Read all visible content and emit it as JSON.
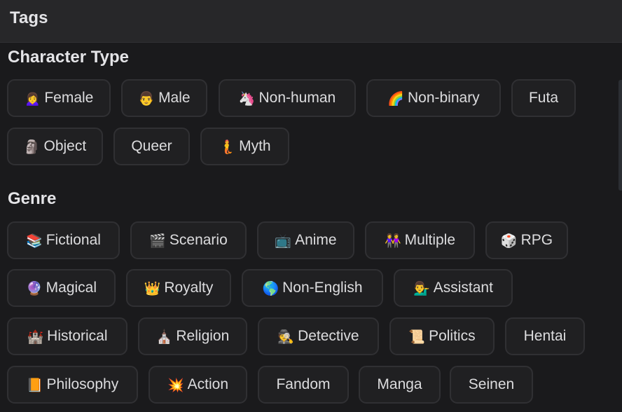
{
  "header": {
    "title": "Tags"
  },
  "sections": [
    {
      "title": "Character Type",
      "rows": [
        [
          {
            "emoji": "🙍‍♀️",
            "icon": "woman-icon",
            "label": "Female"
          },
          {
            "emoji": "👨",
            "icon": "man-icon",
            "label": "Male"
          },
          {
            "emoji": "🦄",
            "icon": "unicorn-icon",
            "label": "Non-human"
          },
          {
            "emoji": "🌈",
            "icon": "rainbow-icon",
            "label": "Non-binary"
          },
          {
            "emoji": "",
            "icon": "",
            "label": "Futa"
          }
        ],
        [
          {
            "emoji": "🗿",
            "icon": "moai-icon",
            "label": "Object"
          },
          {
            "emoji": "",
            "icon": "",
            "label": "Queer"
          },
          {
            "emoji": "🧜",
            "icon": "merperson-icon",
            "label": "Myth"
          }
        ]
      ]
    },
    {
      "title": "Genre",
      "rows": [
        [
          {
            "emoji": "📚",
            "icon": "books-icon",
            "label": "Fictional"
          },
          {
            "emoji": "🎬",
            "icon": "clapper-board-icon",
            "label": "Scenario"
          },
          {
            "emoji": "📺",
            "icon": "television-icon",
            "label": "Anime"
          },
          {
            "emoji": "👭",
            "icon": "two-women-icon",
            "label": "Multiple"
          },
          {
            "emoji": "🎲",
            "icon": "dice-icon",
            "label": "RPG"
          }
        ],
        [
          {
            "emoji": "🔮",
            "icon": "crystal-ball-icon",
            "label": "Magical"
          },
          {
            "emoji": "👑",
            "icon": "crown-icon",
            "label": "Royalty"
          },
          {
            "emoji": "🌎",
            "icon": "globe-icon",
            "label": "Non-English"
          },
          {
            "emoji": "💁‍♂️",
            "icon": "person-tipping-hand-icon",
            "label": "Assistant"
          }
        ],
        [
          {
            "emoji": "🏰",
            "icon": "castle-icon",
            "label": "Historical"
          },
          {
            "emoji": "⛪",
            "icon": "church-icon",
            "label": "Religion"
          },
          {
            "emoji": "🕵️",
            "icon": "detective-icon",
            "label": "Detective"
          },
          {
            "emoji": "📜",
            "icon": "scroll-icon",
            "label": "Politics"
          },
          {
            "emoji": "",
            "icon": "",
            "label": "Hentai"
          }
        ],
        [
          {
            "emoji": "📙",
            "icon": "book-icon",
            "label": "Philosophy"
          },
          {
            "emoji": "💥",
            "icon": "collision-icon",
            "label": "Action"
          },
          {
            "emoji": "",
            "icon": "",
            "label": "Fandom"
          },
          {
            "emoji": "",
            "icon": "",
            "label": "Manga"
          },
          {
            "emoji": "",
            "icon": "",
            "label": "Seinen"
          }
        ]
      ]
    }
  ]
}
